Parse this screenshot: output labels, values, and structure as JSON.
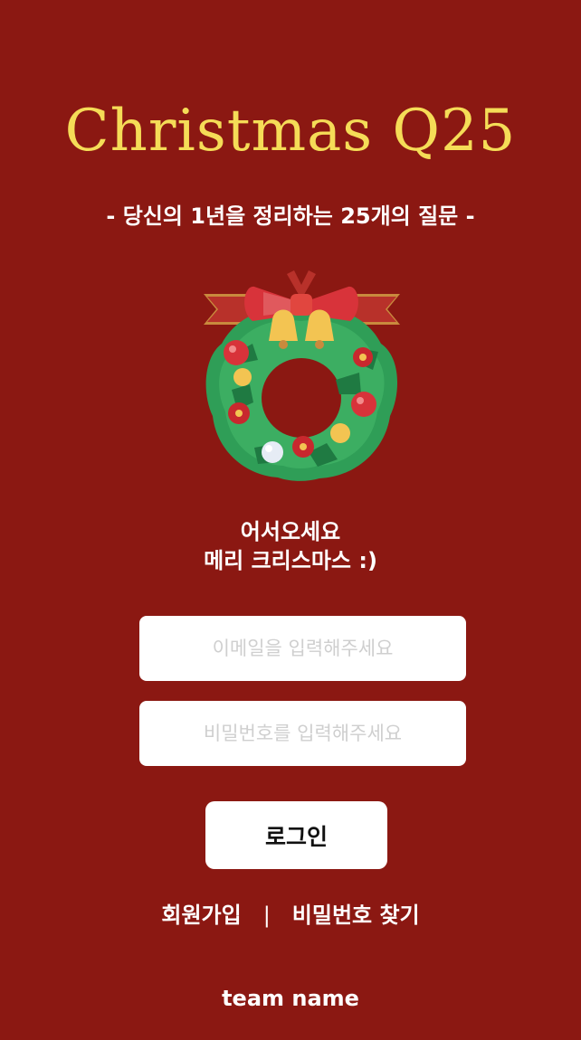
{
  "header": {
    "title": "Christmas Q25",
    "subtitle": "- 당신의 1년을 정리하는 25개의 질문 -"
  },
  "illustration": {
    "icon": "christmas-wreath-icon"
  },
  "welcome": {
    "line1": "어서오세요",
    "line2": "메리 크리스마스 :)"
  },
  "login_form": {
    "email_placeholder": "이메일을 입력해주세요",
    "password_placeholder": "비밀번호를 입력해주세요",
    "login_label": "로그인"
  },
  "links": {
    "signup": "회원가입",
    "separator": "|",
    "find_password": "비밀번호 찾기"
  },
  "footer": {
    "team": "team name"
  },
  "colors": {
    "background": "#8b1812",
    "title": "#f5dc57",
    "text": "#ffffff"
  }
}
